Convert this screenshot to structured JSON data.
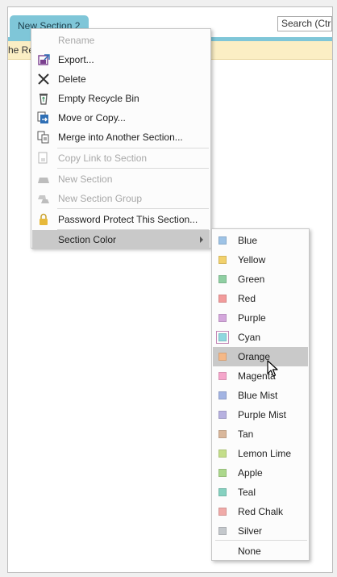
{
  "tab": {
    "title": "New Section 2"
  },
  "search": {
    "text": "Search (Ctrl+"
  },
  "infobar": {
    "text": "he Re"
  },
  "context_menu": {
    "items": [
      {
        "label": "Rename",
        "icon": "rename-icon",
        "disabled": true
      },
      {
        "label": "Export...",
        "icon": "export-icon",
        "disabled": false
      },
      {
        "label": "Delete",
        "icon": "delete-x-icon",
        "disabled": false
      },
      {
        "label": "Empty Recycle Bin",
        "icon": "recycle-bin-icon",
        "disabled": false
      },
      {
        "label": "Move or Copy...",
        "icon": "move-copy-icon",
        "disabled": false
      },
      {
        "label": "Merge into Another Section...",
        "icon": "merge-icon",
        "disabled": false
      },
      {
        "label": "Copy Link to Section",
        "icon": "copy-link-icon",
        "disabled": true
      },
      {
        "label": "New Section",
        "icon": "new-section-icon",
        "disabled": true
      },
      {
        "label": "New Section Group",
        "icon": "new-section-group-icon",
        "disabled": true
      },
      {
        "label": "Password Protect This Section...",
        "icon": "lock-icon",
        "disabled": false
      },
      {
        "label": "Section Color",
        "icon": "",
        "disabled": false,
        "has_submenu": true
      }
    ]
  },
  "color_menu": {
    "items": [
      {
        "label": "Blue",
        "color": "#9ec3e6"
      },
      {
        "label": "Yellow",
        "color": "#f2d16c"
      },
      {
        "label": "Green",
        "color": "#8fcfa2"
      },
      {
        "label": "Red",
        "color": "#f29b9b"
      },
      {
        "label": "Purple",
        "color": "#d4a7dc"
      },
      {
        "label": "Cyan",
        "color": "#8fd8df"
      },
      {
        "label": "Orange",
        "color": "#f5b887"
      },
      {
        "label": "Magenta",
        "color": "#f5a6cb"
      },
      {
        "label": "Blue Mist",
        "color": "#a3b4e3"
      },
      {
        "label": "Purple Mist",
        "color": "#b7b1e0"
      },
      {
        "label": "Tan",
        "color": "#d9b79b"
      },
      {
        "label": "Lemon Lime",
        "color": "#c4de8a"
      },
      {
        "label": "Apple",
        "color": "#acd88c"
      },
      {
        "label": "Teal",
        "color": "#86d1c0"
      },
      {
        "label": "Red Chalk",
        "color": "#f0aaa8"
      },
      {
        "label": "Silver",
        "color": "#c4c8cc"
      }
    ],
    "none_label": "None",
    "hovered": "Orange",
    "current": "Cyan"
  },
  "colors": {
    "tab_accent": "#7fc6d8",
    "infobar_bg": "#fbeec4",
    "menu_highlight": "#c9c9c9"
  }
}
